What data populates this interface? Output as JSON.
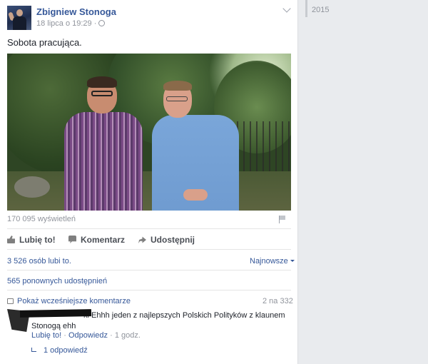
{
  "post": {
    "author": "Zbigniew Stonoga",
    "timestamp": "18 lipca o 19:29 ·",
    "audience_icon": "globe-icon",
    "text": "Sobota pracująca.",
    "views": "170 095 wyświetleń",
    "actions": {
      "like": "Lubię to!",
      "comment": "Komentarz",
      "share": "Udostępnij"
    },
    "likes_summary": "3 526 osób lubi to.",
    "sort_label": "Najnowsze",
    "shares_summary": "565 ponownych udostępnień"
  },
  "comments": {
    "show_previous": "Pokaż wcześniejsze komentarze",
    "page_count": "2 na 332",
    "items": [
      {
        "visible_fragment": "ki",
        "text_line1": "Ehhh jeden z najlepszych Polskich Polityków z klaunem",
        "text_line2": "Stonogą ehh",
        "like_label": "Lubię to!",
        "separator1": " · ",
        "reply_label": "Odpowiedz",
        "separator2": " · ",
        "time": "1 godz.",
        "replies": "1 odpowiedź"
      }
    ]
  },
  "timeline": {
    "year": "2015"
  },
  "colors": {
    "link": "#365899",
    "muted": "#90949c",
    "background": "#e9ebee"
  }
}
